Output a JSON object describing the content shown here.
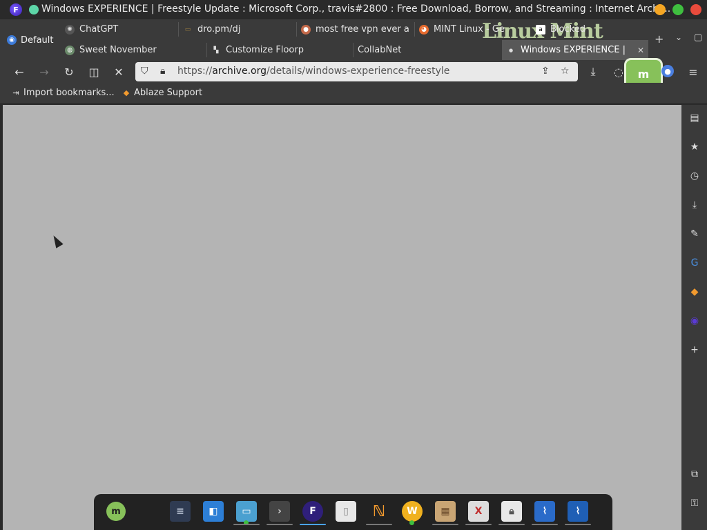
{
  "window": {
    "title": "Windows EXPERIENCE | Freestyle Update : Microsoft Corp., travis#2800 : Free Download, Borrow, and Streaming : Internet Archi..."
  },
  "workspace": {
    "label": "Default"
  },
  "tabs": {
    "row1": [
      {
        "label": "ChatGPT",
        "icon": "chatgpt-icon"
      },
      {
        "label": "dro.pm/dj",
        "icon": "folder-icon"
      },
      {
        "label": "most free vpn ever a",
        "icon": "vpn-icon"
      },
      {
        "label": "MINT Linux - Ge",
        "icon": "firefox-icon"
      },
      {
        "label": "Blocked",
        "icon": "amazon-icon"
      }
    ],
    "row2": [
      {
        "label": "Sweet November",
        "icon": "globe-icon"
      },
      {
        "label": "Customize Floorp",
        "icon": "paint-icon"
      },
      {
        "label": "CollabNet",
        "icon": ""
      },
      {
        "label": "Windows EXPERIENCE |",
        "icon": "loading-icon",
        "active": true
      }
    ],
    "watermark": "Linux Mint"
  },
  "navbar": {
    "url_scheme": "https://",
    "url_host": "archive.org",
    "url_path": "/details/windows-experience-freestyle"
  },
  "bookmarks": [
    {
      "label": "Import bookmarks...",
      "icon": "import-icon"
    },
    {
      "label": "Ablaze Support",
      "icon": "ablaze-icon"
    }
  ],
  "colors": {
    "content_bg": "#b4b4b4",
    "toolbar_bg": "#3a3a3a",
    "active_tab": "#585858",
    "accent": "#4aa3ff"
  }
}
